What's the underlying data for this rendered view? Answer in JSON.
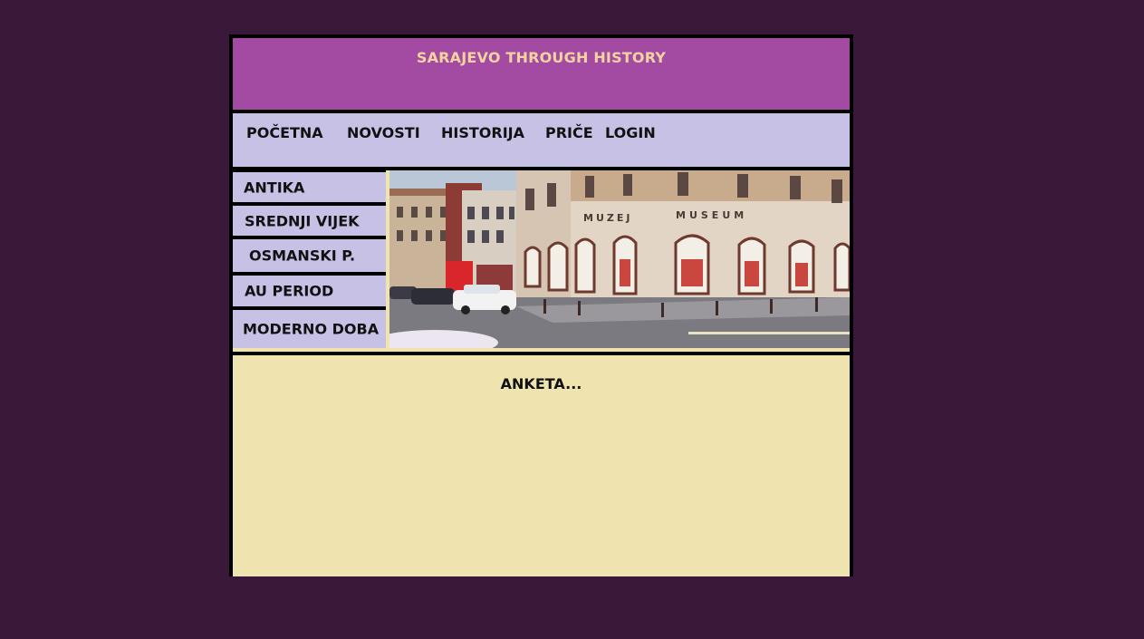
{
  "header": {
    "title": "SARAJEVO THROUGH HISTORY"
  },
  "topnav": {
    "items": [
      "POČETNA",
      "NOVOSTI",
      "HISTORIJA",
      "PRIČE",
      "LOGIN"
    ]
  },
  "sidebar": {
    "items": [
      "ANTIKA",
      "SREDNJI VIJEK",
      "OSMANSKI P.",
      "AU PERIOD",
      "MODERNO DOBA"
    ]
  },
  "photo": {
    "signs": [
      "MUZEJ",
      "MUSEUM"
    ]
  },
  "content": {
    "poll_title": "ANKETA..."
  },
  "colors": {
    "page_background": "#3a1839",
    "header_background": "#a34ba2",
    "title_color": "#f3d3a0",
    "nav_background": "#c7c1e6",
    "content_background": "#efe3b0",
    "border": "#000000"
  }
}
